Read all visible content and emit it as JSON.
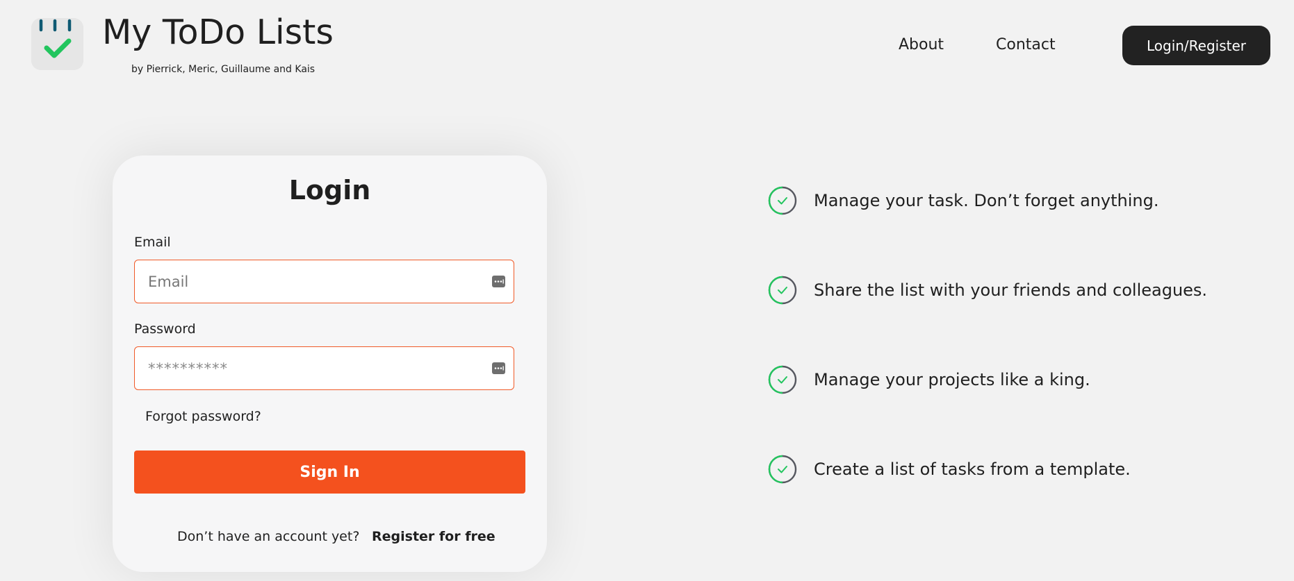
{
  "header": {
    "brand_title": "My ToDo Lists",
    "brand_subtitle": "by Pierrick, Meric, Guillaume and Kais",
    "nav": {
      "about": "About",
      "contact": "Contact"
    },
    "login_register_button": "Login/Register"
  },
  "login": {
    "title": "Login",
    "email_label": "Email",
    "email_placeholder": "Email",
    "email_value": "",
    "password_label": "Password",
    "password_placeholder": "**********",
    "password_value": "",
    "forgot_password": "Forgot password?",
    "sign_in_button": "Sign In",
    "no_account_text": "Don’t have an account yet?",
    "register_link": "Register for free"
  },
  "features": [
    {
      "text": "Manage your task. Don’t forget anything.",
      "icon": "check-circle-icon"
    },
    {
      "text": "Share the list with your friends and colleagues.",
      "icon": "check-circle-icon"
    },
    {
      "text": "Manage your projects like a king.",
      "icon": "check-circle-icon"
    },
    {
      "text": "Create a list of tasks from a template.",
      "icon": "check-circle-icon"
    }
  ],
  "icons": {
    "logo": "calendar-check-logo",
    "field_action": "password-manager-icon"
  },
  "colors": {
    "background": "#f2f2f2",
    "accent": "#f4511e",
    "input_border": "#f05a28",
    "dark_button": "#222222",
    "check_green": "#22c55e",
    "logo_teal": "#0f5a73"
  }
}
